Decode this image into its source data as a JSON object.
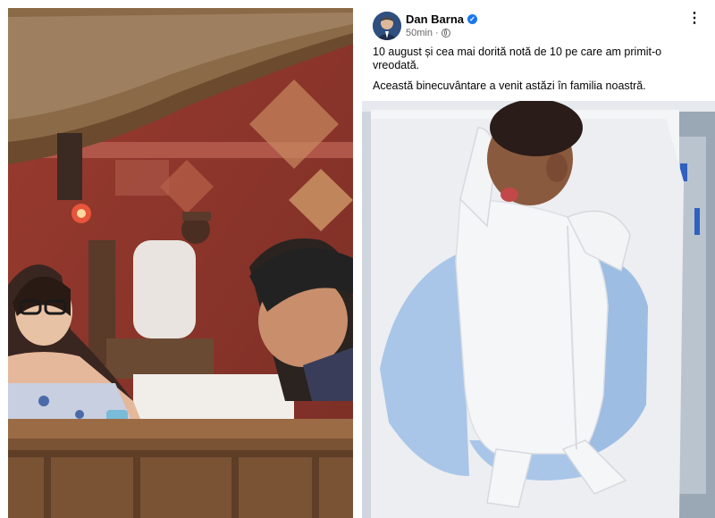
{
  "post": {
    "author": "Dan Barna",
    "time": "50min",
    "paragraph_1": "10 august și cea mai dorită notă de 10 pe care am primit-o vreodată.",
    "paragraph_2": "Această binecuvântare a venit astăzi în familia noastră.",
    "more_label": "⋮",
    "verified_icon": "verified-badge-icon",
    "audience_icon": "globe-icon"
  },
  "colors": {
    "verified": "#1877f2",
    "meta_text": "#65676b",
    "primary_text": "#050505"
  }
}
